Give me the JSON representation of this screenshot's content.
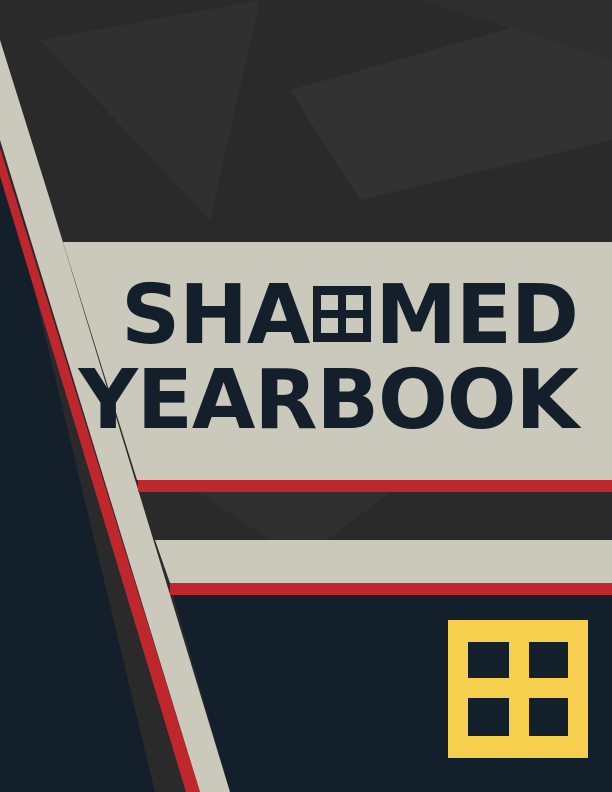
{
  "cover": {
    "title_line_1_before": "SHA",
    "title_line_1_after": "MED",
    "title_line_2": "YEARBOOK"
  },
  "colors": {
    "background": "#2a2a2a",
    "beige": "#cbc8bc",
    "navy": "#13202b",
    "red": "#c0272d",
    "gold": "#f6cf4d"
  },
  "icons": {
    "title_glyph": "hash-cross-icon",
    "emblem": "hash-cross-emblem-icon"
  }
}
